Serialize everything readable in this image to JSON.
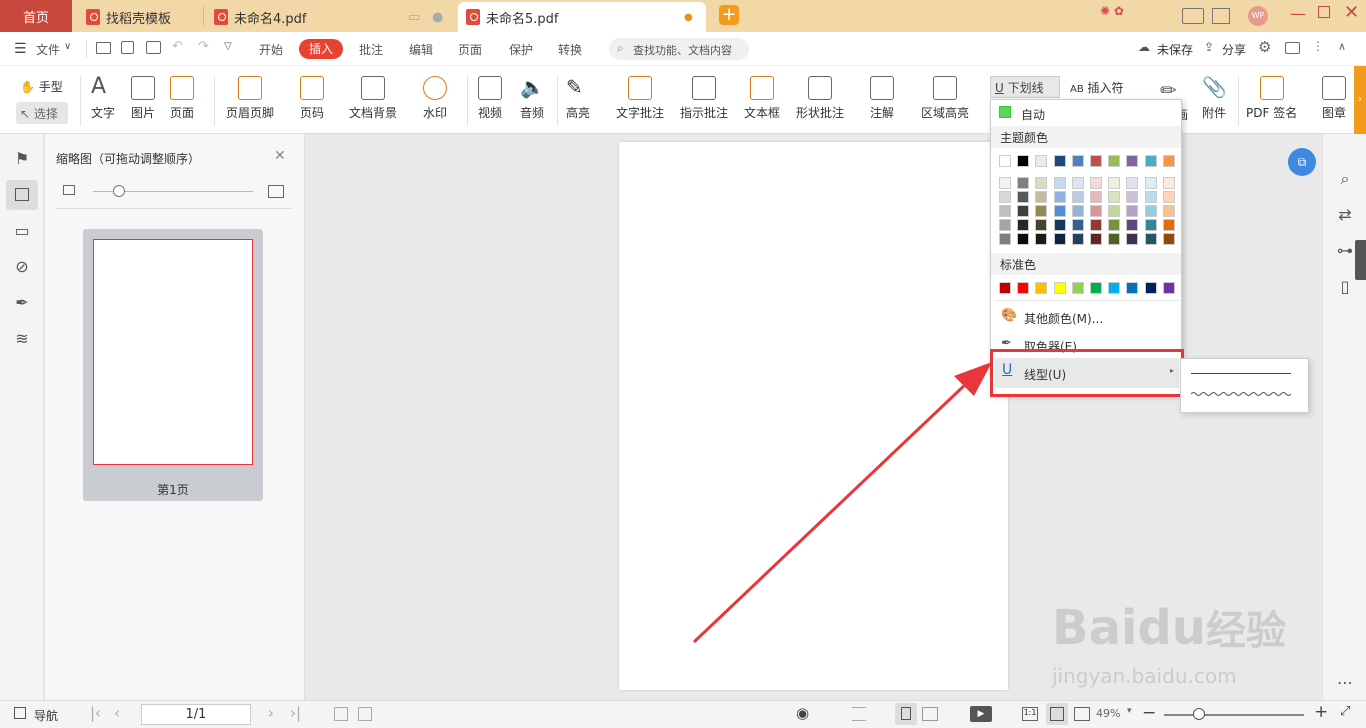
{
  "tabs": {
    "home": "首页",
    "t1": "找稻壳模板",
    "t2": "未命名4.pdf",
    "t3": "未命名5.pdf",
    "avatar": "WP"
  },
  "menubar": {
    "file": "文件",
    "items": [
      "开始",
      "插入",
      "批注",
      "编辑",
      "页面",
      "保护",
      "转换"
    ],
    "active": "插入",
    "search_placeholder": "查找功能、文档内容",
    "unsaved": "未保存",
    "share": "分享"
  },
  "ribbon": {
    "hand": "手型",
    "select": "选择",
    "text": "文字",
    "image": "图片",
    "page": "页面",
    "header_footer": "页眉页脚",
    "page_num": "页码",
    "background": "文档背景",
    "watermark": "水印",
    "video": "视频",
    "audio": "音频",
    "highlight": "高亮",
    "text_note": "文字批注",
    "arrow_note": "指示批注",
    "textbox": "文本框",
    "shape_note": "形状批注",
    "annotate": "注解",
    "area_highlight": "区域高亮",
    "underline": "下划线",
    "insert_symbol": "插入符",
    "attach": "附件",
    "pdf_sign": "PDF 签名",
    "stamp": "图章",
    "partial": "画"
  },
  "thumbs": {
    "title": "缩略图（可拖动调整顺序）",
    "page_label": "第1页"
  },
  "dropdown": {
    "auto": "自动",
    "theme": "主题颜色",
    "standard": "标准色",
    "more": "其他颜色(M)...",
    "picker": "取色器(E)",
    "linetype": "线型(U)",
    "theme_row": [
      "#ffffff",
      "#000000",
      "#eeece1",
      "#1f497d",
      "#4f81bd",
      "#c0504d",
      "#9bbb59",
      "#8064a2",
      "#4bacc6",
      "#f79646"
    ],
    "shades": [
      [
        "#f2f2f2",
        "#7f7f7f",
        "#ddd9c3",
        "#c6d9f0",
        "#dbe5f1",
        "#f2dcdb",
        "#ebf1dd",
        "#e5e0ec",
        "#dbeef3",
        "#fdeada"
      ],
      [
        "#d8d8d8",
        "#595959",
        "#c4bd97",
        "#8db3e2",
        "#b8cce4",
        "#e5b9b7",
        "#d7e3bc",
        "#ccc1d9",
        "#b7dde8",
        "#fbd5b5"
      ],
      [
        "#bfbfbf",
        "#3f3f3f",
        "#938953",
        "#548dd4",
        "#95b3d7",
        "#d99694",
        "#c3d69b",
        "#b2a2c7",
        "#92cddc",
        "#fac08f"
      ],
      [
        "#a5a5a5",
        "#262626",
        "#494429",
        "#17365d",
        "#366092",
        "#953734",
        "#76923c",
        "#5f497a",
        "#31859b",
        "#e36c09"
      ],
      [
        "#7f7f7f",
        "#0c0c0c",
        "#1d1b10",
        "#0f243e",
        "#244061",
        "#632423",
        "#4f6128",
        "#3f3151",
        "#205867",
        "#974806"
      ]
    ],
    "standard_row": [
      "#c00000",
      "#ff0000",
      "#ffc000",
      "#ffff00",
      "#92d050",
      "#00b050",
      "#00b0f0",
      "#0070c0",
      "#002060",
      "#7030a0"
    ]
  },
  "status": {
    "nav": "导航",
    "page": "1/1",
    "zoom": "49%"
  },
  "watermark": {
    "brand": "Baidu",
    "cn": "经验",
    "url": "jingyan.baidu.com"
  }
}
